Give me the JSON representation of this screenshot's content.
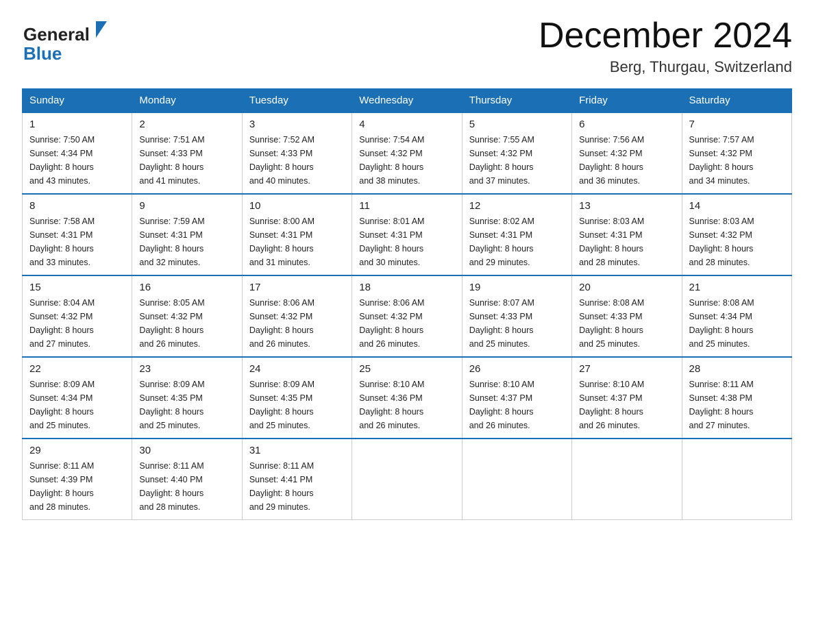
{
  "logo": {
    "general_text": "General",
    "blue_text": "Blue",
    "arrow_color": "#1a6fb5"
  },
  "title": {
    "month_year": "December 2024",
    "location": "Berg, Thurgau, Switzerland"
  },
  "header_row": [
    "Sunday",
    "Monday",
    "Tuesday",
    "Wednesday",
    "Thursday",
    "Friday",
    "Saturday"
  ],
  "weeks": [
    [
      {
        "day": "1",
        "sunrise": "7:50 AM",
        "sunset": "4:34 PM",
        "daylight": "8 hours and 43 minutes."
      },
      {
        "day": "2",
        "sunrise": "7:51 AM",
        "sunset": "4:33 PM",
        "daylight": "8 hours and 41 minutes."
      },
      {
        "day": "3",
        "sunrise": "7:52 AM",
        "sunset": "4:33 PM",
        "daylight": "8 hours and 40 minutes."
      },
      {
        "day": "4",
        "sunrise": "7:54 AM",
        "sunset": "4:32 PM",
        "daylight": "8 hours and 38 minutes."
      },
      {
        "day": "5",
        "sunrise": "7:55 AM",
        "sunset": "4:32 PM",
        "daylight": "8 hours and 37 minutes."
      },
      {
        "day": "6",
        "sunrise": "7:56 AM",
        "sunset": "4:32 PM",
        "daylight": "8 hours and 36 minutes."
      },
      {
        "day": "7",
        "sunrise": "7:57 AM",
        "sunset": "4:32 PM",
        "daylight": "8 hours and 34 minutes."
      }
    ],
    [
      {
        "day": "8",
        "sunrise": "7:58 AM",
        "sunset": "4:31 PM",
        "daylight": "8 hours and 33 minutes."
      },
      {
        "day": "9",
        "sunrise": "7:59 AM",
        "sunset": "4:31 PM",
        "daylight": "8 hours and 32 minutes."
      },
      {
        "day": "10",
        "sunrise": "8:00 AM",
        "sunset": "4:31 PM",
        "daylight": "8 hours and 31 minutes."
      },
      {
        "day": "11",
        "sunrise": "8:01 AM",
        "sunset": "4:31 PM",
        "daylight": "8 hours and 30 minutes."
      },
      {
        "day": "12",
        "sunrise": "8:02 AM",
        "sunset": "4:31 PM",
        "daylight": "8 hours and 29 minutes."
      },
      {
        "day": "13",
        "sunrise": "8:03 AM",
        "sunset": "4:31 PM",
        "daylight": "8 hours and 28 minutes."
      },
      {
        "day": "14",
        "sunrise": "8:03 AM",
        "sunset": "4:32 PM",
        "daylight": "8 hours and 28 minutes."
      }
    ],
    [
      {
        "day": "15",
        "sunrise": "8:04 AM",
        "sunset": "4:32 PM",
        "daylight": "8 hours and 27 minutes."
      },
      {
        "day": "16",
        "sunrise": "8:05 AM",
        "sunset": "4:32 PM",
        "daylight": "8 hours and 26 minutes."
      },
      {
        "day": "17",
        "sunrise": "8:06 AM",
        "sunset": "4:32 PM",
        "daylight": "8 hours and 26 minutes."
      },
      {
        "day": "18",
        "sunrise": "8:06 AM",
        "sunset": "4:32 PM",
        "daylight": "8 hours and 26 minutes."
      },
      {
        "day": "19",
        "sunrise": "8:07 AM",
        "sunset": "4:33 PM",
        "daylight": "8 hours and 25 minutes."
      },
      {
        "day": "20",
        "sunrise": "8:08 AM",
        "sunset": "4:33 PM",
        "daylight": "8 hours and 25 minutes."
      },
      {
        "day": "21",
        "sunrise": "8:08 AM",
        "sunset": "4:34 PM",
        "daylight": "8 hours and 25 minutes."
      }
    ],
    [
      {
        "day": "22",
        "sunrise": "8:09 AM",
        "sunset": "4:34 PM",
        "daylight": "8 hours and 25 minutes."
      },
      {
        "day": "23",
        "sunrise": "8:09 AM",
        "sunset": "4:35 PM",
        "daylight": "8 hours and 25 minutes."
      },
      {
        "day": "24",
        "sunrise": "8:09 AM",
        "sunset": "4:35 PM",
        "daylight": "8 hours and 25 minutes."
      },
      {
        "day": "25",
        "sunrise": "8:10 AM",
        "sunset": "4:36 PM",
        "daylight": "8 hours and 26 minutes."
      },
      {
        "day": "26",
        "sunrise": "8:10 AM",
        "sunset": "4:37 PM",
        "daylight": "8 hours and 26 minutes."
      },
      {
        "day": "27",
        "sunrise": "8:10 AM",
        "sunset": "4:37 PM",
        "daylight": "8 hours and 26 minutes."
      },
      {
        "day": "28",
        "sunrise": "8:11 AM",
        "sunset": "4:38 PM",
        "daylight": "8 hours and 27 minutes."
      }
    ],
    [
      {
        "day": "29",
        "sunrise": "8:11 AM",
        "sunset": "4:39 PM",
        "daylight": "8 hours and 28 minutes."
      },
      {
        "day": "30",
        "sunrise": "8:11 AM",
        "sunset": "4:40 PM",
        "daylight": "8 hours and 28 minutes."
      },
      {
        "day": "31",
        "sunrise": "8:11 AM",
        "sunset": "4:41 PM",
        "daylight": "8 hours and 29 minutes."
      },
      null,
      null,
      null,
      null
    ]
  ],
  "labels": {
    "sunrise": "Sunrise:",
    "sunset": "Sunset:",
    "daylight": "Daylight:"
  }
}
